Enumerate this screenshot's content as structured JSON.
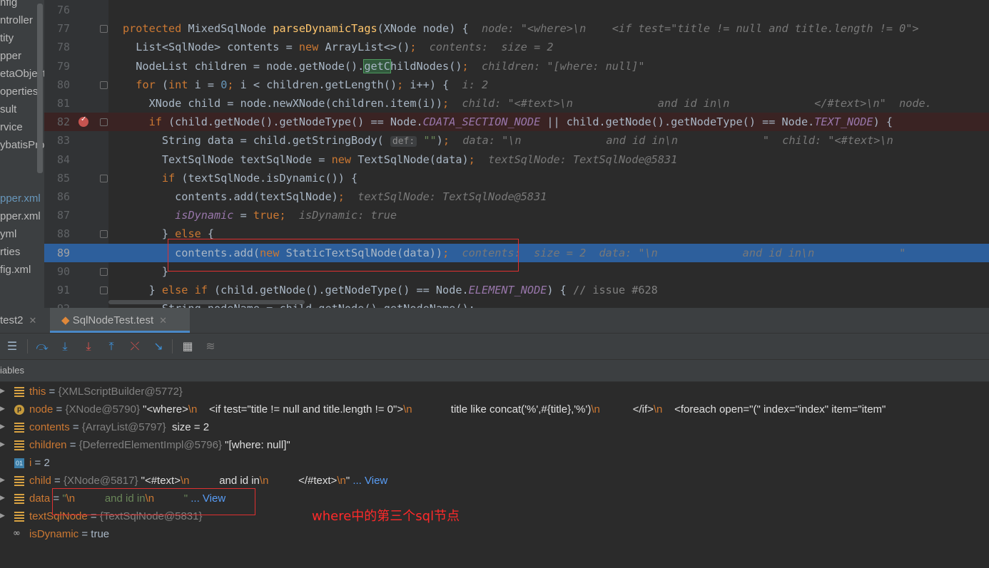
{
  "project_tree": {
    "items": [
      {
        "label": "nfig",
        "color": "normal"
      },
      {
        "label": "ntroller",
        "color": "normal"
      },
      {
        "label": "tity",
        "color": "normal"
      },
      {
        "label": "pper",
        "color": "normal"
      },
      {
        "label": "etaObject",
        "color": "normal"
      },
      {
        "label": "operties",
        "color": "normal"
      },
      {
        "label": "sult",
        "color": "normal"
      },
      {
        "label": "rvice",
        "color": "normal"
      },
      {
        "label": "ybatisPro",
        "color": "normal"
      },
      {
        "label": "",
        "color": "normal"
      },
      {
        "label": "",
        "color": "normal"
      },
      {
        "label": "pper.xml",
        "color": "blue"
      },
      {
        "label": "pper.xml",
        "color": "normal"
      },
      {
        "label": "yml",
        "color": "normal"
      },
      {
        "label": "rties",
        "color": "normal"
      },
      {
        "label": "fig.xml",
        "color": "normal"
      }
    ]
  },
  "editor": {
    "current_line": 89,
    "breakpoint_line": 82,
    "lines": [
      {
        "n": "76",
        "segs": []
      },
      {
        "n": "77",
        "segs": [
          {
            "t": "protected ",
            "c": "kw"
          },
          {
            "t": "MixedSqlNode ",
            "c": ""
          },
          {
            "t": "parseDynamicTags",
            "c": "fn"
          },
          {
            "t": "(XNode node) {  ",
            "c": ""
          },
          {
            "t": "node: \"<where>\\n    <if test=\"title != null and title.length != 0\">",
            "c": "hint"
          }
        ]
      },
      {
        "n": "78",
        "segs": [
          {
            "t": "  List<SqlNode> contents = ",
            "c": ""
          },
          {
            "t": "new ",
            "c": "kw"
          },
          {
            "t": "ArrayList<>()",
            "c": ""
          },
          {
            "t": ";  ",
            "c": "kw"
          },
          {
            "t": "contents:  size = 2",
            "c": "hint"
          }
        ]
      },
      {
        "n": "79",
        "segs": [
          {
            "t": "  NodeList children = node.getNode().",
            "c": ""
          },
          {
            "t": "getC",
            "c": "hl"
          },
          {
            "t": "hildNodes()",
            "c": ""
          },
          {
            "t": ";  ",
            "c": "kw"
          },
          {
            "t": "children: \"[where: null]\"",
            "c": "hint"
          }
        ]
      },
      {
        "n": "80",
        "segs": [
          {
            "t": "  ",
            "c": ""
          },
          {
            "t": "for ",
            "c": "kw"
          },
          {
            "t": "(",
            "c": ""
          },
          {
            "t": "int ",
            "c": "kw"
          },
          {
            "t": "i = ",
            "c": ""
          },
          {
            "t": "0",
            "c": "nm"
          },
          {
            "t": "; ",
            "c": "kw"
          },
          {
            "t": "i < children.getLength()",
            "c": ""
          },
          {
            "t": "; ",
            "c": "kw"
          },
          {
            "t": "i++) {  ",
            "c": ""
          },
          {
            "t": "i: 2",
            "c": "hint"
          }
        ]
      },
      {
        "n": "81",
        "segs": [
          {
            "t": "    XNode child = node.newXNode(children.item(i))",
            "c": ""
          },
          {
            "t": ";  ",
            "c": "kw"
          },
          {
            "t": "child: \"<#text>\\n             and id in\\n             </#text>\\n\"  node.",
            "c": "hint"
          }
        ]
      },
      {
        "n": "82",
        "segs": [
          {
            "t": "    ",
            "c": ""
          },
          {
            "t": "if ",
            "c": "kw"
          },
          {
            "t": "(child.getNode().getNodeType() == Node.",
            "c": ""
          },
          {
            "t": "CDATA_SECTION_NODE",
            "c": "cn"
          },
          {
            "t": " || child.getNode().getNodeType() == Node.",
            "c": ""
          },
          {
            "t": "TEXT_NODE",
            "c": "cn"
          },
          {
            "t": ") {",
            "c": ""
          }
        ]
      },
      {
        "n": "83",
        "segs": [
          {
            "t": "      String data = child.getStringBody( ",
            "c": ""
          },
          {
            "t": "def:",
            "c": "dflt"
          },
          {
            "t": " ",
            "c": ""
          },
          {
            "t": "\"\"",
            "c": "st"
          },
          {
            "t": ")",
            "c": ""
          },
          {
            "t": ";  ",
            "c": "kw"
          },
          {
            "t": "data: \"\\n             and id in\\n             \"  child: \"<#text>\\n",
            "c": "hint"
          }
        ]
      },
      {
        "n": "84",
        "segs": [
          {
            "t": "      TextSqlNode textSqlNode = ",
            "c": ""
          },
          {
            "t": "new ",
            "c": "kw"
          },
          {
            "t": "TextSqlNode(data)",
            "c": ""
          },
          {
            "t": ";  ",
            "c": "kw"
          },
          {
            "t": "textSqlNode: TextSqlNode@5831",
            "c": "hint"
          }
        ]
      },
      {
        "n": "85",
        "segs": [
          {
            "t": "      ",
            "c": ""
          },
          {
            "t": "if ",
            "c": "kw"
          },
          {
            "t": "(textSqlNode.isDynamic()) {",
            "c": ""
          }
        ]
      },
      {
        "n": "86",
        "segs": [
          {
            "t": "        contents.add(textSqlNode)",
            "c": ""
          },
          {
            "t": ";  ",
            "c": "kw"
          },
          {
            "t": "textSqlNode: TextSqlNode@5831",
            "c": "hint"
          }
        ]
      },
      {
        "n": "87",
        "segs": [
          {
            "t": "        ",
            "c": ""
          },
          {
            "t": "isDynamic",
            "c": "cn"
          },
          {
            "t": " = ",
            "c": ""
          },
          {
            "t": "true",
            "c": "kw"
          },
          {
            "t": ";  ",
            "c": "kw"
          },
          {
            "t": "isDynamic: true",
            "c": "hint"
          }
        ]
      },
      {
        "n": "88",
        "segs": [
          {
            "t": "      } ",
            "c": ""
          },
          {
            "t": "else ",
            "c": "kw"
          },
          {
            "t": "{",
            "c": ""
          }
        ]
      },
      {
        "n": "89",
        "segs": [
          {
            "t": "        contents.add(",
            "c": ""
          },
          {
            "t": "new ",
            "c": "kw"
          },
          {
            "t": "StaticTextSqlNode(data))",
            "c": ""
          },
          {
            "t": ";  ",
            "c": "kw"
          },
          {
            "t": "contents:  size = 2  data: \"\\n             and id in\\n             \"",
            "c": "hint"
          }
        ]
      },
      {
        "n": "90",
        "segs": [
          {
            "t": "      }",
            "c": ""
          }
        ]
      },
      {
        "n": "91",
        "segs": [
          {
            "t": "    } ",
            "c": ""
          },
          {
            "t": "else if ",
            "c": "kw"
          },
          {
            "t": "(child.getNode().getNodeType() == Node.",
            "c": ""
          },
          {
            "t": "ELEMENT_NODE",
            "c": "cn"
          },
          {
            "t": ") { ",
            "c": ""
          },
          {
            "t": "// issue #628",
            "c": "cm"
          }
        ]
      },
      {
        "n": "92",
        "segs": [
          {
            "t": "      String nodeName = child.getNode().getNodeName();",
            "c": ""
          }
        ]
      }
    ]
  },
  "debug": {
    "tabs": [
      {
        "label": "test2",
        "active": false
      },
      {
        "label": "SqlNodeTest.test",
        "active": true
      }
    ],
    "variables_label": "iables",
    "toolbar_icons": [
      "frames-icon",
      "step-over-icon",
      "step-into-icon",
      "force-step-into-icon",
      "step-out-icon",
      "drop-frame-icon",
      "run-to-cursor-icon",
      "evaluate-icon",
      "trace-icon"
    ],
    "variables": [
      {
        "icon": "field",
        "name": "this",
        "segs": [
          {
            "t": " = ",
            "c": "eq"
          },
          {
            "t": "{XMLScriptBuilder@5772}",
            "c": "ref"
          }
        ]
      },
      {
        "icon": "p",
        "name": "node",
        "segs": [
          {
            "t": " = ",
            "c": "eq"
          },
          {
            "t": "{XNode@5790} ",
            "c": "ref"
          },
          {
            "t": "\"<where>",
            "c": "sv"
          },
          {
            "t": "\\n",
            "c": "esc"
          },
          {
            "t": "    <if test=\"title != null and title.length != 0\">",
            "c": "sv"
          },
          {
            "t": "\\n",
            "c": "esc"
          },
          {
            "t": "             title like concat('%',#{title},'%')",
            "c": "sv"
          },
          {
            "t": "\\n",
            "c": "esc"
          },
          {
            "t": "           </if>",
            "c": "sv"
          },
          {
            "t": "\\n",
            "c": "esc"
          },
          {
            "t": "    <foreach open=\"(\" index=\"index\" item=\"item\"",
            "c": "sv"
          }
        ]
      },
      {
        "icon": "field",
        "name": "contents",
        "segs": [
          {
            "t": " = ",
            "c": "eq"
          },
          {
            "t": "{ArrayList@5797} ",
            "c": "ref"
          },
          {
            "t": " size = 2",
            "c": "sv"
          }
        ]
      },
      {
        "icon": "field",
        "name": "children",
        "segs": [
          {
            "t": " = ",
            "c": "eq"
          },
          {
            "t": "{DeferredElementImpl@5796} ",
            "c": "ref"
          },
          {
            "t": "\"[where: null]\"",
            "c": "sv"
          }
        ]
      },
      {
        "icon": "int",
        "name": "i",
        "segs": [
          {
            "t": " = 2",
            "c": "plain"
          }
        ]
      },
      {
        "icon": "field",
        "name": "child",
        "segs": [
          {
            "t": " = ",
            "c": "eq"
          },
          {
            "t": "{XNode@5817} ",
            "c": "ref"
          },
          {
            "t": "\"<#text>",
            "c": "sv"
          },
          {
            "t": "\\n",
            "c": "esc"
          },
          {
            "t": "          and id in",
            "c": "sv"
          },
          {
            "t": "\\n",
            "c": "esc"
          },
          {
            "t": "          </#text>",
            "c": "sv"
          },
          {
            "t": "\\n",
            "c": "esc"
          },
          {
            "t": "\" ",
            "c": "sv"
          },
          {
            "t": "... View",
            "c": "view"
          }
        ]
      },
      {
        "icon": "field",
        "name": "data",
        "segs": [
          {
            "t": " = ",
            "c": "eq"
          },
          {
            "t": "\"",
            "c": "ok"
          },
          {
            "t": "\\n",
            "c": "esc"
          },
          {
            "t": "          and id in",
            "c": "ok"
          },
          {
            "t": "\\n",
            "c": "esc"
          },
          {
            "t": "          \" ",
            "c": "ok"
          },
          {
            "t": "... View",
            "c": "view"
          }
        ]
      },
      {
        "icon": "field",
        "name": "textSqlNode",
        "segs": [
          {
            "t": " = ",
            "c": "eq"
          },
          {
            "t": "{TextSqlNode@5831}",
            "c": "ref"
          }
        ]
      },
      {
        "icon": "oo",
        "name": "isDynamic",
        "segs": [
          {
            "t": " = true",
            "c": "plain"
          }
        ]
      }
    ]
  },
  "annotation": {
    "note": "where中的第三个sql节点",
    "color": "#ff2a2a"
  },
  "colors": {
    "editor_bg": "#2b2b2b",
    "current_line": "#2d5f9c",
    "breakpoint": "#c75450",
    "keyword": "#cc7832",
    "function": "#ffc66d",
    "string": "#6a8759"
  }
}
